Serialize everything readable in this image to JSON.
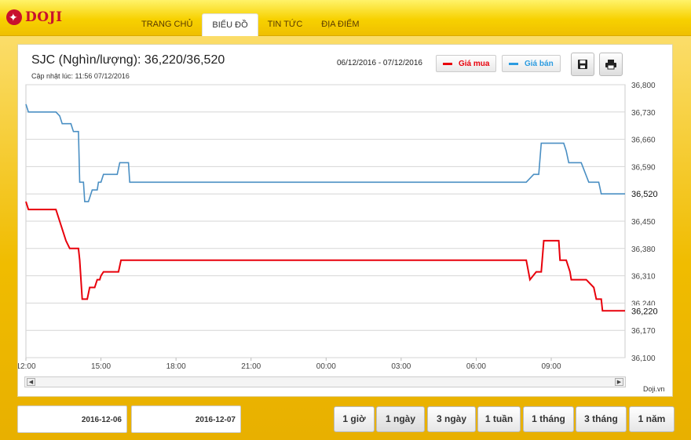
{
  "brand": {
    "name": "DOJI"
  },
  "nav": [
    {
      "label": "TRANG CHỦ"
    },
    {
      "label": "BIỂU ĐỒ",
      "active": true
    },
    {
      "label": "TIN TỨC"
    },
    {
      "label": "ĐỊA ĐIỂM"
    }
  ],
  "panel": {
    "title": "SJC (Nghìn/lượng): 36,220/36,520",
    "updated": "Cập nhật lúc: 11:56 07/12/2016",
    "date_range": "06/12/2016 - 07/12/2016",
    "legend": [
      {
        "label": "Giá mua",
        "color": "#e8000b"
      },
      {
        "label": "Giá bán",
        "color": "#2b9be0"
      }
    ],
    "save_icon": "floppy-disk-icon",
    "print_icon": "printer-icon",
    "credit": "Doji.vn"
  },
  "chart_data": {
    "type": "line",
    "x_ticks": [
      "12:00",
      "15:00",
      "18:00",
      "21:00",
      "00:00",
      "03:00",
      "06:00",
      "09:00"
    ],
    "x_range_hours": [
      12,
      35.95
    ],
    "ylim": [
      36100,
      36800
    ],
    "y_ticks": [
      "36,800",
      "36,730",
      "36,660",
      "36,590",
      "36,520",
      "36,450",
      "36,380",
      "36,310",
      "36,240",
      "36,170",
      "36,100"
    ],
    "last_labels": {
      "Giá bán": "36,520",
      "Giá mua": "36,220"
    },
    "series": [
      {
        "name": "Giá bán",
        "color": "#4a8fc3",
        "points": [
          [
            12.0,
            36750
          ],
          [
            12.1,
            36730
          ],
          [
            13.2,
            36730
          ],
          [
            13.35,
            36720
          ],
          [
            13.45,
            36700
          ],
          [
            13.8,
            36700
          ],
          [
            13.9,
            36680
          ],
          [
            14.1,
            36680
          ],
          [
            14.15,
            36550
          ],
          [
            14.3,
            36550
          ],
          [
            14.35,
            36500
          ],
          [
            14.5,
            36500
          ],
          [
            14.65,
            36530
          ],
          [
            14.85,
            36530
          ],
          [
            14.9,
            36550
          ],
          [
            15.0,
            36550
          ],
          [
            15.05,
            36560
          ],
          [
            15.1,
            36570
          ],
          [
            15.65,
            36570
          ],
          [
            15.75,
            36600
          ],
          [
            16.1,
            36600
          ],
          [
            16.15,
            36550
          ],
          [
            32.0,
            36550
          ],
          [
            32.3,
            36570
          ],
          [
            32.5,
            36570
          ],
          [
            32.6,
            36650
          ],
          [
            33.5,
            36650
          ],
          [
            33.6,
            36630
          ],
          [
            33.7,
            36600
          ],
          [
            34.2,
            36600
          ],
          [
            34.5,
            36550
          ],
          [
            34.9,
            36550
          ],
          [
            35.0,
            36520
          ],
          [
            35.95,
            36520
          ]
        ]
      },
      {
        "name": "Giá mua",
        "color": "#e8000b",
        "points": [
          [
            12.0,
            36500
          ],
          [
            12.1,
            36480
          ],
          [
            13.2,
            36480
          ],
          [
            13.35,
            36450
          ],
          [
            13.5,
            36420
          ],
          [
            13.6,
            36400
          ],
          [
            13.75,
            36380
          ],
          [
            14.1,
            36380
          ],
          [
            14.15,
            36350
          ],
          [
            14.25,
            36250
          ],
          [
            14.45,
            36250
          ],
          [
            14.55,
            36280
          ],
          [
            14.75,
            36280
          ],
          [
            14.85,
            36300
          ],
          [
            14.95,
            36300
          ],
          [
            15.0,
            36310
          ],
          [
            15.1,
            36320
          ],
          [
            15.7,
            36320
          ],
          [
            15.8,
            36350
          ],
          [
            32.0,
            36350
          ],
          [
            32.15,
            36300
          ],
          [
            32.4,
            36320
          ],
          [
            32.6,
            36320
          ],
          [
            32.7,
            36400
          ],
          [
            33.3,
            36400
          ],
          [
            33.35,
            36350
          ],
          [
            33.6,
            36350
          ],
          [
            33.75,
            36320
          ],
          [
            33.8,
            36300
          ],
          [
            34.4,
            36300
          ],
          [
            34.7,
            36280
          ],
          [
            34.8,
            36250
          ],
          [
            35.0,
            36250
          ],
          [
            35.05,
            36220
          ],
          [
            35.95,
            36220
          ]
        ]
      }
    ]
  },
  "controls": {
    "from_date": "2016-12-06",
    "to_date": "2016-12-07",
    "ranges": [
      {
        "label": "1 giờ"
      },
      {
        "label": "1 ngày",
        "active": true
      },
      {
        "label": "3 ngày"
      },
      {
        "label": "1 tuần"
      },
      {
        "label": "1 tháng"
      },
      {
        "label": "3 tháng"
      },
      {
        "label": "1 năm"
      }
    ]
  }
}
